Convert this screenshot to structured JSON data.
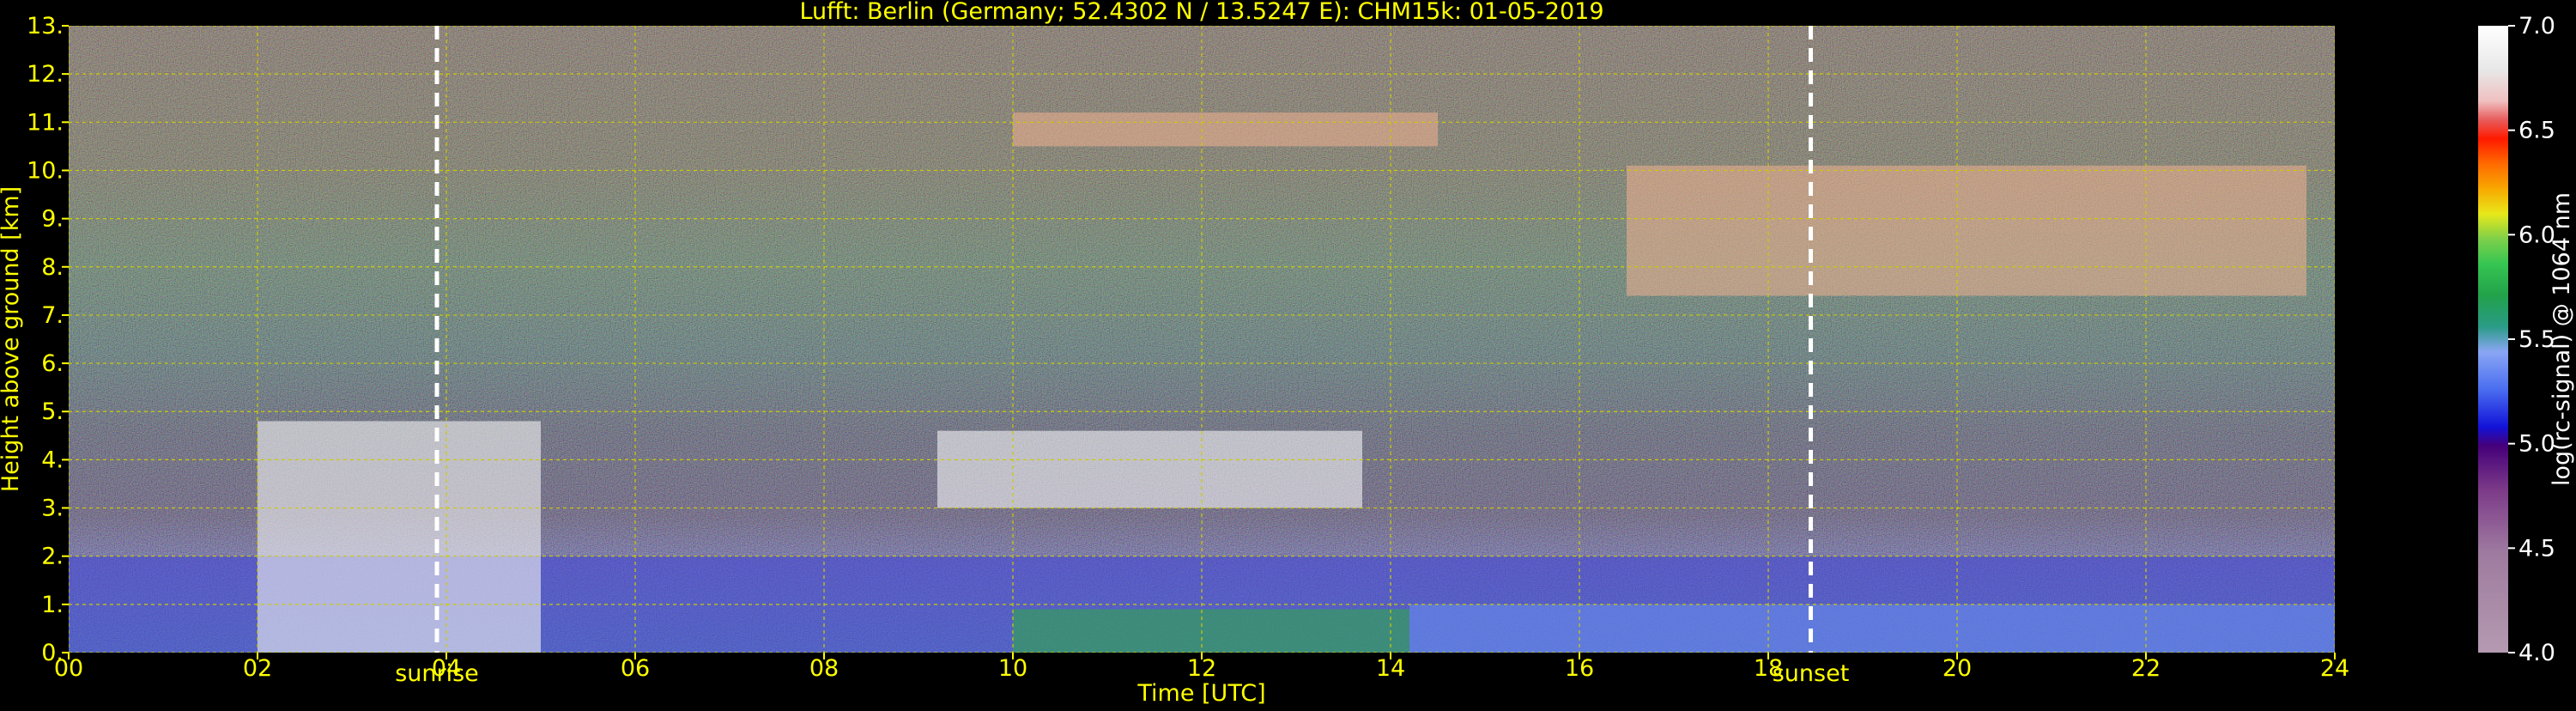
{
  "chart_data": {
    "type": "heatmap",
    "title": "Lufft: Berlin (Germany; 52.4302 N / 13.5247 E):    CHM15k: 01-05-2019",
    "xlabel": "Time [UTC]",
    "ylabel": "Height above ground [km]",
    "xlim": [
      0,
      24
    ],
    "ylim": [
      0,
      13
    ],
    "x_ticks": [
      0,
      2,
      4,
      6,
      8,
      10,
      12,
      14,
      16,
      18,
      20,
      22,
      24
    ],
    "x_tick_labels": [
      "00",
      "02",
      "04",
      "06",
      "08",
      "10",
      "12",
      "14",
      "16",
      "18",
      "20",
      "22",
      "24"
    ],
    "y_ticks": [
      0,
      1,
      2,
      3,
      4,
      5,
      6,
      7,
      8,
      9,
      10,
      11,
      12,
      13
    ],
    "y_tick_labels": [
      "0.",
      "1.",
      "2.",
      "3.",
      "4.",
      "5.",
      "6.",
      "7.",
      "8.",
      "9.",
      "10.",
      "11.",
      "12.",
      "13."
    ],
    "grid": true,
    "annotations": [
      {
        "text": "sunrise",
        "x": 3.9
      },
      {
        "text": "sunset",
        "x": 18.45
      }
    ],
    "colorbar": {
      "label": "log(rc-signal) @ 1064 nm",
      "range": [
        4.0,
        7.0
      ],
      "ticks": [
        4.0,
        4.5,
        5.0,
        5.5,
        6.0,
        6.5,
        7.0
      ],
      "tick_labels": [
        "4.0",
        "4.5",
        "5.0",
        "5.5",
        "6.0",
        "6.5",
        "7.0"
      ]
    },
    "features": [
      {
        "kind": "boundary-layer",
        "x_start": 0,
        "x_end": 24,
        "top_km": 2.0
      },
      {
        "kind": "low-cloud",
        "x_start": 2.0,
        "x_end": 5.0,
        "base_km": 0.0,
        "top_km": 4.8
      },
      {
        "kind": "mid-cloud",
        "x_start": 9.2,
        "x_end": 13.7,
        "base_km": 3.0,
        "top_km": 4.6
      },
      {
        "kind": "cirrus",
        "x_start": 10.0,
        "x_end": 14.5,
        "base_km": 10.5,
        "top_km": 11.2
      },
      {
        "kind": "cirrus",
        "x_start": 16.5,
        "x_end": 23.7,
        "base_km": 7.4,
        "top_km": 10.1
      }
    ]
  },
  "colors": {
    "title": "#ffff00",
    "axis_text": "#ffff00",
    "grid": "#cccc00",
    "markers": "#ffffff",
    "background": "#000000"
  }
}
